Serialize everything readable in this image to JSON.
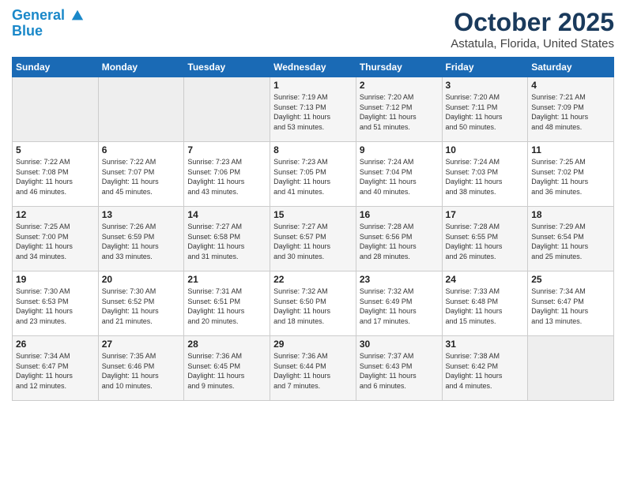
{
  "logo": {
    "line1": "General",
    "line2": "Blue"
  },
  "title": "October 2025",
  "subtitle": "Astatula, Florida, United States",
  "days_of_week": [
    "Sunday",
    "Monday",
    "Tuesday",
    "Wednesday",
    "Thursday",
    "Friday",
    "Saturday"
  ],
  "weeks": [
    [
      {
        "day": "",
        "info": ""
      },
      {
        "day": "",
        "info": ""
      },
      {
        "day": "",
        "info": ""
      },
      {
        "day": "1",
        "info": "Sunrise: 7:19 AM\nSunset: 7:13 PM\nDaylight: 11 hours\nand 53 minutes."
      },
      {
        "day": "2",
        "info": "Sunrise: 7:20 AM\nSunset: 7:12 PM\nDaylight: 11 hours\nand 51 minutes."
      },
      {
        "day": "3",
        "info": "Sunrise: 7:20 AM\nSunset: 7:11 PM\nDaylight: 11 hours\nand 50 minutes."
      },
      {
        "day": "4",
        "info": "Sunrise: 7:21 AM\nSunset: 7:09 PM\nDaylight: 11 hours\nand 48 minutes."
      }
    ],
    [
      {
        "day": "5",
        "info": "Sunrise: 7:22 AM\nSunset: 7:08 PM\nDaylight: 11 hours\nand 46 minutes."
      },
      {
        "day": "6",
        "info": "Sunrise: 7:22 AM\nSunset: 7:07 PM\nDaylight: 11 hours\nand 45 minutes."
      },
      {
        "day": "7",
        "info": "Sunrise: 7:23 AM\nSunset: 7:06 PM\nDaylight: 11 hours\nand 43 minutes."
      },
      {
        "day": "8",
        "info": "Sunrise: 7:23 AM\nSunset: 7:05 PM\nDaylight: 11 hours\nand 41 minutes."
      },
      {
        "day": "9",
        "info": "Sunrise: 7:24 AM\nSunset: 7:04 PM\nDaylight: 11 hours\nand 40 minutes."
      },
      {
        "day": "10",
        "info": "Sunrise: 7:24 AM\nSunset: 7:03 PM\nDaylight: 11 hours\nand 38 minutes."
      },
      {
        "day": "11",
        "info": "Sunrise: 7:25 AM\nSunset: 7:02 PM\nDaylight: 11 hours\nand 36 minutes."
      }
    ],
    [
      {
        "day": "12",
        "info": "Sunrise: 7:25 AM\nSunset: 7:00 PM\nDaylight: 11 hours\nand 34 minutes."
      },
      {
        "day": "13",
        "info": "Sunrise: 7:26 AM\nSunset: 6:59 PM\nDaylight: 11 hours\nand 33 minutes."
      },
      {
        "day": "14",
        "info": "Sunrise: 7:27 AM\nSunset: 6:58 PM\nDaylight: 11 hours\nand 31 minutes."
      },
      {
        "day": "15",
        "info": "Sunrise: 7:27 AM\nSunset: 6:57 PM\nDaylight: 11 hours\nand 30 minutes."
      },
      {
        "day": "16",
        "info": "Sunrise: 7:28 AM\nSunset: 6:56 PM\nDaylight: 11 hours\nand 28 minutes."
      },
      {
        "day": "17",
        "info": "Sunrise: 7:28 AM\nSunset: 6:55 PM\nDaylight: 11 hours\nand 26 minutes."
      },
      {
        "day": "18",
        "info": "Sunrise: 7:29 AM\nSunset: 6:54 PM\nDaylight: 11 hours\nand 25 minutes."
      }
    ],
    [
      {
        "day": "19",
        "info": "Sunrise: 7:30 AM\nSunset: 6:53 PM\nDaylight: 11 hours\nand 23 minutes."
      },
      {
        "day": "20",
        "info": "Sunrise: 7:30 AM\nSunset: 6:52 PM\nDaylight: 11 hours\nand 21 minutes."
      },
      {
        "day": "21",
        "info": "Sunrise: 7:31 AM\nSunset: 6:51 PM\nDaylight: 11 hours\nand 20 minutes."
      },
      {
        "day": "22",
        "info": "Sunrise: 7:32 AM\nSunset: 6:50 PM\nDaylight: 11 hours\nand 18 minutes."
      },
      {
        "day": "23",
        "info": "Sunrise: 7:32 AM\nSunset: 6:49 PM\nDaylight: 11 hours\nand 17 minutes."
      },
      {
        "day": "24",
        "info": "Sunrise: 7:33 AM\nSunset: 6:48 PM\nDaylight: 11 hours\nand 15 minutes."
      },
      {
        "day": "25",
        "info": "Sunrise: 7:34 AM\nSunset: 6:47 PM\nDaylight: 11 hours\nand 13 minutes."
      }
    ],
    [
      {
        "day": "26",
        "info": "Sunrise: 7:34 AM\nSunset: 6:47 PM\nDaylight: 11 hours\nand 12 minutes."
      },
      {
        "day": "27",
        "info": "Sunrise: 7:35 AM\nSunset: 6:46 PM\nDaylight: 11 hours\nand 10 minutes."
      },
      {
        "day": "28",
        "info": "Sunrise: 7:36 AM\nSunset: 6:45 PM\nDaylight: 11 hours\nand 9 minutes."
      },
      {
        "day": "29",
        "info": "Sunrise: 7:36 AM\nSunset: 6:44 PM\nDaylight: 11 hours\nand 7 minutes."
      },
      {
        "day": "30",
        "info": "Sunrise: 7:37 AM\nSunset: 6:43 PM\nDaylight: 11 hours\nand 6 minutes."
      },
      {
        "day": "31",
        "info": "Sunrise: 7:38 AM\nSunset: 6:42 PM\nDaylight: 11 hours\nand 4 minutes."
      },
      {
        "day": "",
        "info": ""
      }
    ]
  ]
}
